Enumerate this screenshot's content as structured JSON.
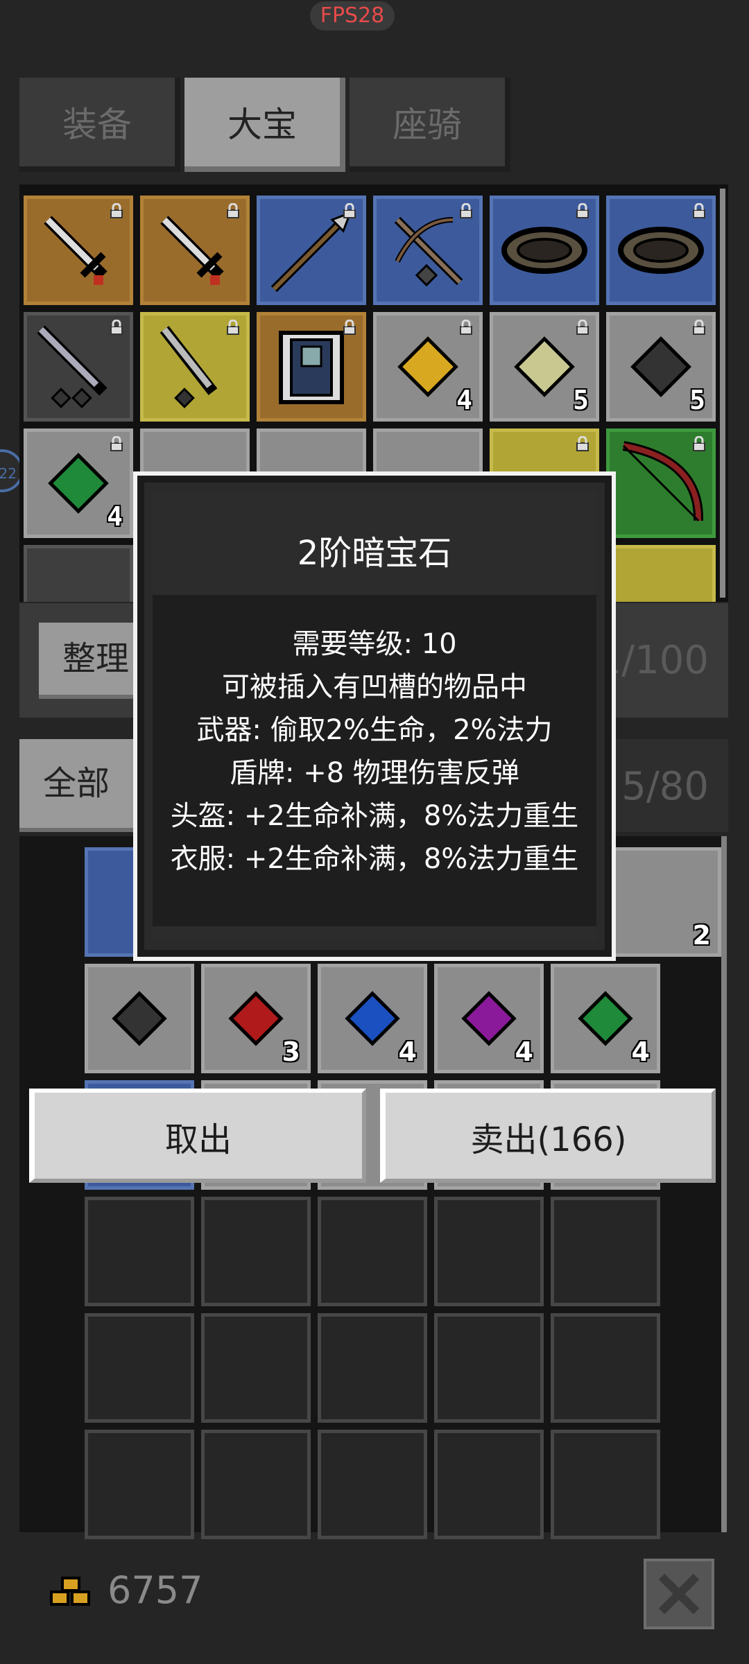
{
  "fps": "FPS28",
  "tabs": [
    {
      "label": "装备",
      "active": false
    },
    {
      "label": "大宝",
      "active": true
    },
    {
      "label": "座骑",
      "active": false
    }
  ],
  "upper_grid": {
    "counts": {
      "r1c4": "4",
      "r1c5": "5",
      "r1c6": "5",
      "r2c1": "4"
    }
  },
  "organize_button": "整理",
  "storage_count": "1/100",
  "filter_button": "全部",
  "inventory_count": "5/80",
  "inventory": {
    "counts": [
      "2",
      "3",
      "4",
      "4",
      "4",
      "2"
    ]
  },
  "item_dialog": {
    "title": "2阶暗宝石",
    "lines": [
      "需要等级: 10",
      "可被插入有凹槽的物品中",
      "武器: 偷取2%生命，2%法力",
      "盾牌: +8 物理伤害反弹",
      "头盔: +2生命补满，8%法力重生",
      "衣服: +2生命补满，8%法力重生"
    ]
  },
  "actions": {
    "take_out": "取出",
    "sell": "卖出(166)"
  },
  "gold": "6757",
  "side_badge": "22"
}
